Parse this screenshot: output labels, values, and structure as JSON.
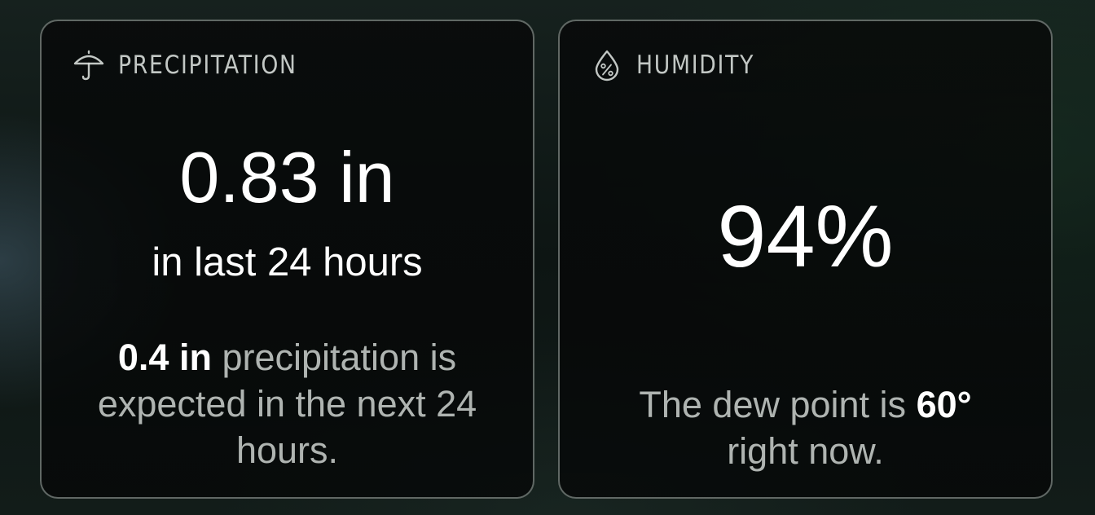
{
  "precipitation": {
    "icon": "umbrella-icon",
    "title": "PRECIPITATION",
    "value": "0.83 in",
    "period": "in last 24 hours",
    "forecast_amount": "0.4 in",
    "forecast_text": " precipitation is expected in the next 24 hours."
  },
  "humidity": {
    "icon": "humidity-drop-icon",
    "title": "HUMIDITY",
    "value": "94%",
    "dew_point_prefix": "The dew point is ",
    "dew_point_value": "60°",
    "dew_point_suffix": " right now."
  },
  "colors": {
    "card_border": "#9aa49f",
    "text_primary": "#ffffff",
    "text_secondary": "#cdd2cf"
  }
}
